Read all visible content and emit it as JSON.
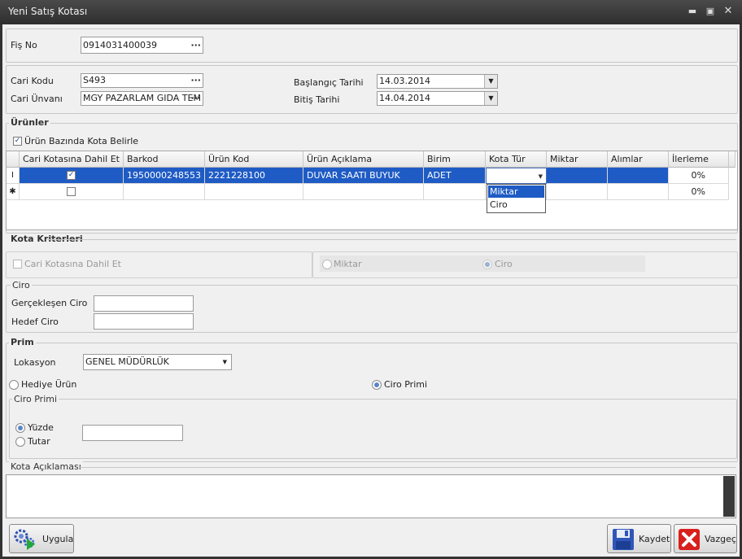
{
  "window": {
    "title": "Yeni Satış Kotası"
  },
  "fis": {
    "label": "Fiş No",
    "value": "0914031400039"
  },
  "cari": {
    "kodu_label": "Cari Kodu",
    "kodu_value": "S493",
    "unvani_label": "Cari Ünvanı",
    "unvani_value": "MGY PAZARLAM GIDA TEM",
    "baslangic_label": "Başlangıç Tarihi",
    "baslangic_value": "14.03.2014",
    "bitis_label": "Bitiş Tarihi",
    "bitis_value": "14.04.2014"
  },
  "urunler": {
    "title": "Ürünler",
    "checkbox_label": "Ürün Bazında Kota Belirle",
    "columns": [
      "Cari Kotasına Dahil Et",
      "Barkod",
      "Ürün Kod",
      "Ürün Açıklama",
      "Birim",
      "Kota Tür",
      "Miktar",
      "Alımlar",
      "İlerleme"
    ],
    "rows": [
      {
        "barkod": "1950000248553",
        "urun_kod": "2221228100",
        "aciklama": "DUVAR SAATI BUYUK",
        "birim": "ADET",
        "kota_tur": "",
        "miktar": "",
        "alimlar": "",
        "ilerleme": "0%"
      },
      {
        "barkod": "",
        "urun_kod": "",
        "aciklama": "",
        "birim": "",
        "kota_tur": "",
        "miktar": "",
        "alimlar": "",
        "ilerleme": "0%"
      }
    ],
    "dropdown_options": [
      "Miktar",
      "Ciro"
    ]
  },
  "kota_kriterleri": {
    "title": "Kota Kriterleri",
    "cari_dahil": "Cari Kotasına Dahil Et",
    "miktar": "Miktar",
    "ciro": "Ciro"
  },
  "ciro": {
    "title": "Ciro",
    "gerceklesen_label": "Gerçekleşen Ciro",
    "hedef_label": "Hedef Ciro"
  },
  "prim": {
    "title": "Prim",
    "lokasyon_label": "Lokasyon",
    "lokasyon_value": "GENEL MÜDÜRLÜK",
    "hediye": "Hediye Ürün",
    "ciro_primi": "Ciro Primi",
    "ciro_primi_group": "Ciro Primi",
    "yuzde": "Yüzde",
    "tutar": "Tutar"
  },
  "aciklama": {
    "title": "Kota Açıklaması"
  },
  "buttons": {
    "uygula": "Uygula",
    "kaydet": "Kaydet",
    "vazgec": "Vazgeç"
  }
}
